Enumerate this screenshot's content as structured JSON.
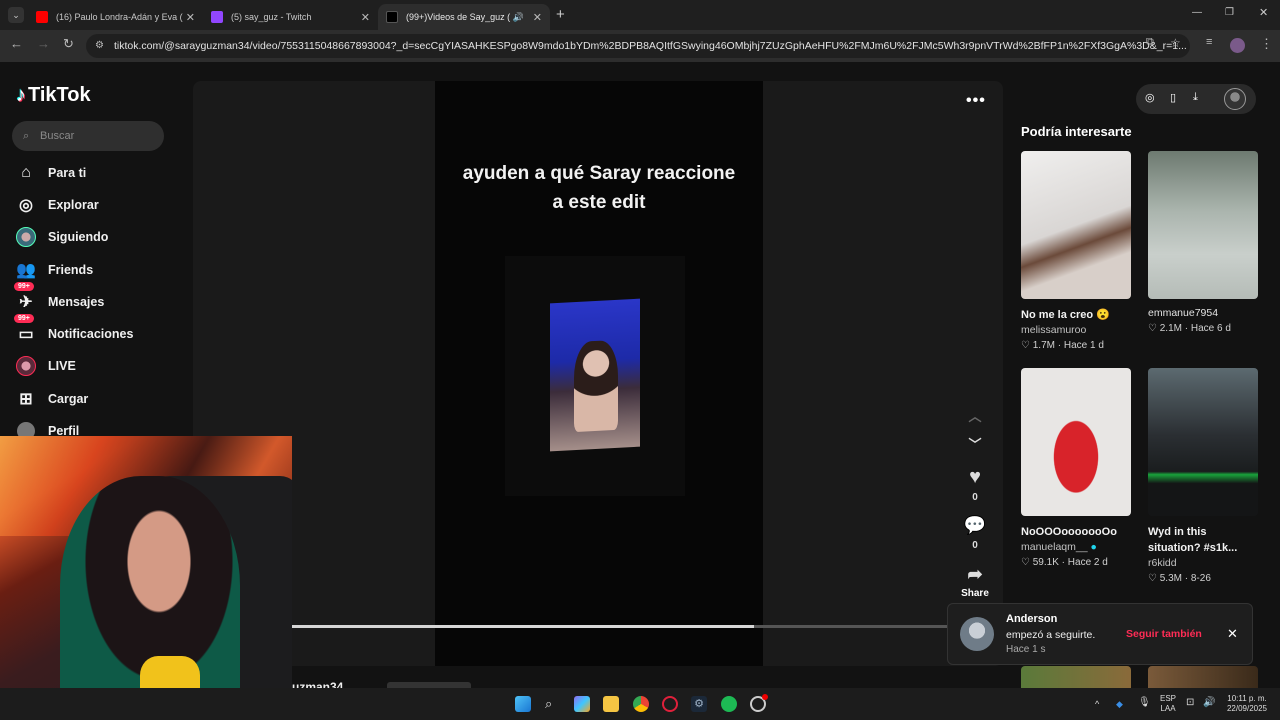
{
  "browser": {
    "tabs": [
      {
        "title": "(16) Paulo Londra-Adán y Eva (",
        "icon": "youtube-icon",
        "color": "#ff0000"
      },
      {
        "title": "(5) say_guz - Twitch",
        "icon": "twitch-icon",
        "color": "#9146ff"
      },
      {
        "title": "(99+)Videos de Say_guz (",
        "icon": "tiktok-icon",
        "color": "#000000"
      }
    ],
    "new_tab": "+",
    "url": "tiktok.com/@sarayguzman34/video/7553115048667893004?_d=secCgYIASAHKESPgo8W9mdo1bYDm%2BDPB8AQItfGSwying46OMbjhj7ZUzGphAeHFU%2FMJm6U%2FJMc5Wh3r9pnVTrWd%2BfFP1n%2FXf3GgA%3D&_r=1..."
  },
  "sidebar": {
    "logo": "TikTok",
    "search_placeholder": "Buscar",
    "items": [
      {
        "label": "Para ti",
        "icon": "home-icon"
      },
      {
        "label": "Explorar",
        "icon": "compass-icon"
      },
      {
        "label": "Siguiendo",
        "icon": "avatar-icon"
      },
      {
        "label": "Friends",
        "icon": "friends-icon"
      },
      {
        "label": "Mensajes",
        "icon": "messages-icon",
        "badge": "99+"
      },
      {
        "label": "Notificaciones",
        "icon": "notifications-icon",
        "badge": "99+"
      },
      {
        "label": "LIVE",
        "icon": "live-icon"
      },
      {
        "label": "Cargar",
        "icon": "upload-icon"
      },
      {
        "label": "Perfil",
        "icon": "profile-icon"
      }
    ]
  },
  "video": {
    "caption_line1": "ayuden a qué Saray reaccione",
    "caption_line2": "a este edit",
    "progress": 0.7,
    "likes": "0",
    "comments": "0",
    "share_label": "Share",
    "author_partial": "uzman34"
  },
  "recommend": {
    "title": "Podría interesarte",
    "cards": [
      {
        "title": "No me la creo 😮",
        "user": "melissamuroo",
        "likes": "1.7M",
        "age": "Hace 1 d"
      },
      {
        "title": "",
        "user": "emmanue7954",
        "likes": "2.1M",
        "age": "Hace 6 d"
      },
      {
        "title": "NoOOOooooooOo",
        "user": "manuelaqm__",
        "likes": "59.1K",
        "age": "Hace 2 d"
      },
      {
        "title": "Wyd in this situation? #s1k...",
        "user": "r6kidd",
        "likes": "5.3M",
        "age": "8-26"
      }
    ]
  },
  "toast": {
    "name": "Anderson",
    "message": "empezó a seguirte.",
    "time": "Hace 1 s",
    "action": "Seguir también"
  },
  "taskbar": {
    "lang_top": "ESP",
    "lang_bottom": "LAA",
    "time": "10:11 p. m.",
    "date": "22/09/2025"
  }
}
